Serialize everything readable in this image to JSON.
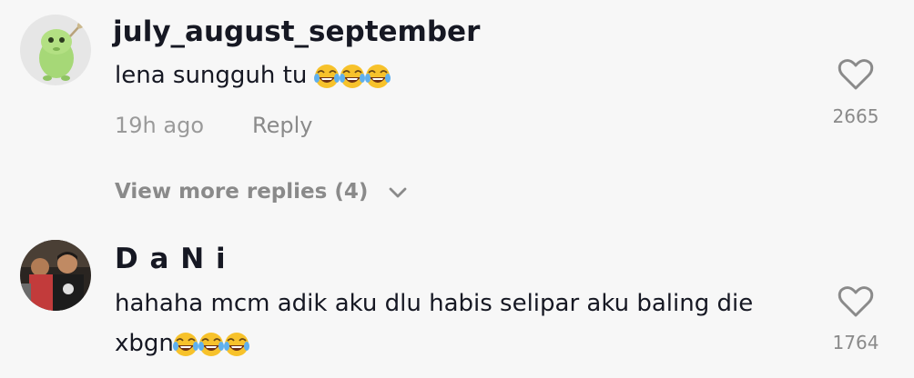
{
  "comments": [
    {
      "username": "july_august_september",
      "text": "lena sungguh tu",
      "emoji_count": 3,
      "emoji_icon": "face-with-tears-of-joy-icon",
      "time": "19h ago",
      "reply_label": "Reply",
      "likes": "2665"
    },
    {
      "username": "D a N i",
      "text_line1": "hahaha mcm adik aku dlu habis selipar aku baling die",
      "text_line2": "xbgn",
      "emoji_count": 3,
      "emoji_icon": "face-with-tears-of-joy-icon",
      "likes": "1764"
    }
  ],
  "view_more": {
    "label": "View more replies (4)"
  },
  "colors": {
    "background": "#f7f7f7",
    "primary_text": "#161823",
    "secondary_text": "#8a8a8a"
  }
}
